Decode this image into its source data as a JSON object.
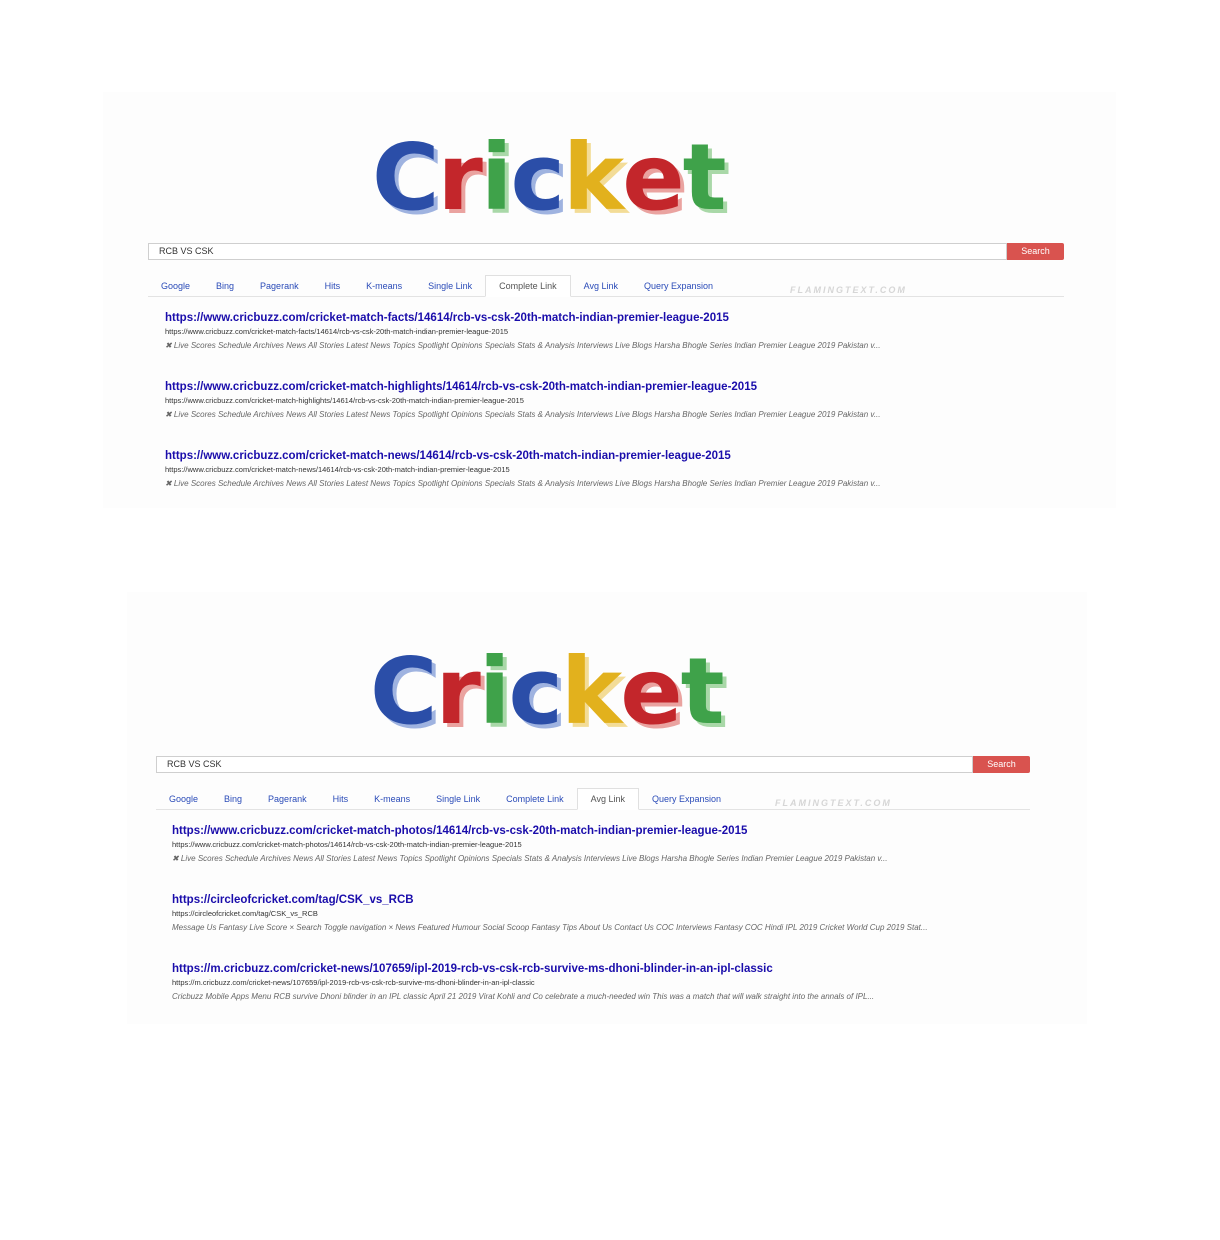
{
  "panels": [
    {
      "logo": "Cricket",
      "search": {
        "value": "RCB VS CSK",
        "button": "Search"
      },
      "tabs": [
        "Google",
        "Bing",
        "Pagerank",
        "Hits",
        "K-means",
        "Single Link",
        "Complete Link",
        "Avg Link",
        "Query Expansion"
      ],
      "active_tab": "Complete Link",
      "watermark": "FLAMINGTEXT.COM",
      "results": [
        {
          "title": "https://www.cricbuzz.com/cricket-match-facts/14614/rcb-vs-csk-20th-match-indian-premier-league-2015",
          "url": "https://www.cricbuzz.com/cricket-match-facts/14614/rcb-vs-csk-20th-match-indian-premier-league-2015",
          "snippet": "✖ Live Scores Schedule Archives News All Stories Latest News Topics Spotlight Opinions Specials Stats & Analysis Interviews Live Blogs Harsha Bhogle Series Indian Premier League 2019 Pakistan v..."
        },
        {
          "title": "https://www.cricbuzz.com/cricket-match-highlights/14614/rcb-vs-csk-20th-match-indian-premier-league-2015",
          "url": "https://www.cricbuzz.com/cricket-match-highlights/14614/rcb-vs-csk-20th-match-indian-premier-league-2015",
          "snippet": "✖ Live Scores Schedule Archives News All Stories Latest News Topics Spotlight Opinions Specials Stats & Analysis Interviews Live Blogs Harsha Bhogle Series Indian Premier League 2019 Pakistan v..."
        },
        {
          "title": "https://www.cricbuzz.com/cricket-match-news/14614/rcb-vs-csk-20th-match-indian-premier-league-2015",
          "url": "https://www.cricbuzz.com/cricket-match-news/14614/rcb-vs-csk-20th-match-indian-premier-league-2015",
          "snippet": "✖ Live Scores Schedule Archives News All Stories Latest News Topics Spotlight Opinions Specials Stats & Analysis Interviews Live Blogs Harsha Bhogle Series Indian Premier League 2019 Pakistan v..."
        }
      ]
    },
    {
      "logo": "Cricket",
      "search": {
        "value": "RCB VS CSK",
        "button": "Search"
      },
      "tabs": [
        "Google",
        "Bing",
        "Pagerank",
        "Hits",
        "K-means",
        "Single Link",
        "Complete Link",
        "Avg Link",
        "Query Expansion"
      ],
      "active_tab": "Avg Link",
      "watermark": "FLAMINGTEXT.COM",
      "results": [
        {
          "title": "https://www.cricbuzz.com/cricket-match-photos/14614/rcb-vs-csk-20th-match-indian-premier-league-2015",
          "url": "https://www.cricbuzz.com/cricket-match-photos/14614/rcb-vs-csk-20th-match-indian-premier-league-2015",
          "snippet": "✖ Live Scores Schedule Archives News All Stories Latest News Topics Spotlight Opinions Specials Stats & Analysis Interviews Live Blogs Harsha Bhogle Series Indian Premier League 2019 Pakistan v..."
        },
        {
          "title": "https://circleofcricket.com/tag/CSK_vs_RCB",
          "url": "https://circleofcricket.com/tag/CSK_vs_RCB",
          "snippet": "Message Us Fantasy Live Score × Search Toggle navigation × News Featured Humour Social Scoop Fantasy Tips About Us Contact Us COC Interviews Fantasy COC Hindi IPL 2019 Cricket World Cup 2019 Stat..."
        },
        {
          "title": "https://m.cricbuzz.com/cricket-news/107659/ipl-2019-rcb-vs-csk-rcb-survive-ms-dhoni-blinder-in-an-ipl-classic",
          "url": "https://m.cricbuzz.com/cricket-news/107659/ipl-2019-rcb-vs-csk-rcb-survive-ms-dhoni-blinder-in-an-ipl-classic",
          "snippet": "Cricbuzz Mobile Apps Menu RCB survive Dhoni blinder in an IPL classic April 21 2019 Virat Kohli and Co celebrate a much-needed win This was a match that will walk straight into the annals of IPL..."
        }
      ]
    }
  ]
}
